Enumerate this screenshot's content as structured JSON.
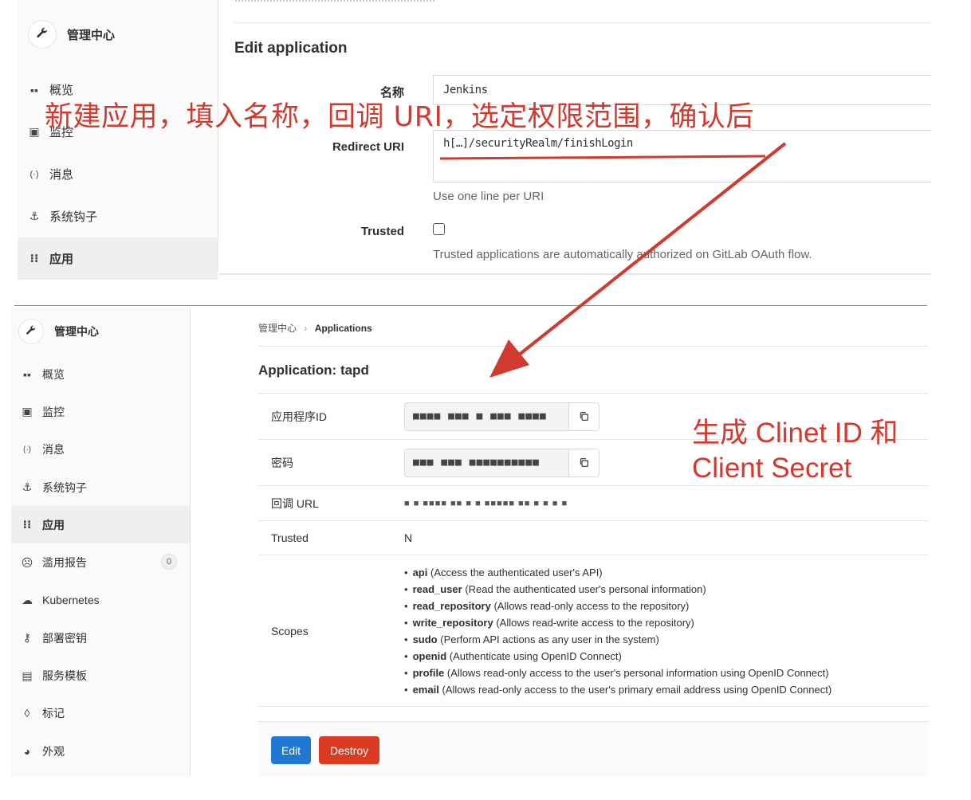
{
  "top_panel": {
    "sidebar": {
      "header": "管理中心",
      "items": [
        {
          "label": "概览",
          "icon": "grid-icon",
          "active": false
        },
        {
          "label": "监控",
          "icon": "monitor-icon",
          "active": false
        },
        {
          "label": "消息",
          "icon": "broadcast-icon",
          "active": false
        },
        {
          "label": "系统钩子",
          "icon": "hook-icon",
          "active": false
        },
        {
          "label": "应用",
          "icon": "apps-icon",
          "active": true
        }
      ]
    },
    "form": {
      "title": "Edit application",
      "name_label": "名称",
      "name_value": "Jenkins",
      "redirect_label": "Redirect URI",
      "redirect_value": "h[…]/securityRealm/finishLogin",
      "redirect_help": "Use one line per URI",
      "trusted_label": "Trusted",
      "trusted_checked": false,
      "trusted_help": "Trusted applications are automatically authorized on GitLab OAuth flow."
    }
  },
  "bottom_panel": {
    "sidebar": {
      "header": "管理中心",
      "items": [
        {
          "label": "概览",
          "icon": "grid-icon",
          "active": false
        },
        {
          "label": "监控",
          "icon": "monitor-icon",
          "active": false
        },
        {
          "label": "消息",
          "icon": "broadcast-icon",
          "active": false
        },
        {
          "label": "系统钩子",
          "icon": "hook-icon",
          "active": false
        },
        {
          "label": "应用",
          "icon": "apps-icon",
          "active": true
        },
        {
          "label": "滥用报告",
          "icon": "smiley-icon",
          "active": false,
          "badge": "0"
        },
        {
          "label": "Kubernetes",
          "icon": "cloud-gear-icon",
          "active": false
        },
        {
          "label": "部署密钥",
          "icon": "key-icon",
          "active": false
        },
        {
          "label": "服务模板",
          "icon": "template-icon",
          "active": false
        },
        {
          "label": "标记",
          "icon": "labels-icon",
          "active": false
        },
        {
          "label": "外观",
          "icon": "palette-icon",
          "active": false
        }
      ]
    },
    "breadcrumb": {
      "parent": "管理中心",
      "separator": "›",
      "current": "Applications"
    },
    "title": "Application: tapd",
    "rows": {
      "app_id_label": "应用程序ID",
      "app_id_value": "■■■■ ■■■ ■  ■■■ ■■■■",
      "secret_label": "密码",
      "secret_value": "■■■ ■■■ ■■■■■■■■■■",
      "callback_label": "回调 URL",
      "callback_value": "■    ■   ■■■■ ■■ ■  ■ ■■■■■ ■■  ■ ■ ■ ■",
      "trusted_label": "Trusted",
      "trusted_value": "N",
      "scopes_label": "Scopes"
    },
    "scopes": [
      {
        "name": "api",
        "desc": "(Access the authenticated user's API)"
      },
      {
        "name": "read_user",
        "desc": "(Read the authenticated user's personal information)"
      },
      {
        "name": "read_repository",
        "desc": "(Allows read-only access to the repository)"
      },
      {
        "name": "write_repository",
        "desc": "(Allows read-write access to the repository)"
      },
      {
        "name": "sudo",
        "desc": "(Perform API actions as any user in the system)"
      },
      {
        "name": "openid",
        "desc": "(Authenticate using OpenID Connect)"
      },
      {
        "name": "profile",
        "desc": "(Allows read-only access to the user's personal information using OpenID Connect)"
      },
      {
        "name": "email",
        "desc": "(Allows read-only access to the user's primary email address using OpenID Connect)"
      }
    ],
    "buttons": {
      "edit": "Edit",
      "destroy": "Destroy"
    }
  },
  "annotations": {
    "top_text": "新建应用，填入名称，回调 URI，选定权限范围，确认后",
    "right_line1": "生成 Clinet ID 和",
    "right_line2": "Client Secret",
    "color": "#d03a2f"
  },
  "colors": {
    "primary": "#1f78d1",
    "danger": "#db3b21",
    "annotation": "#d03a2f"
  }
}
